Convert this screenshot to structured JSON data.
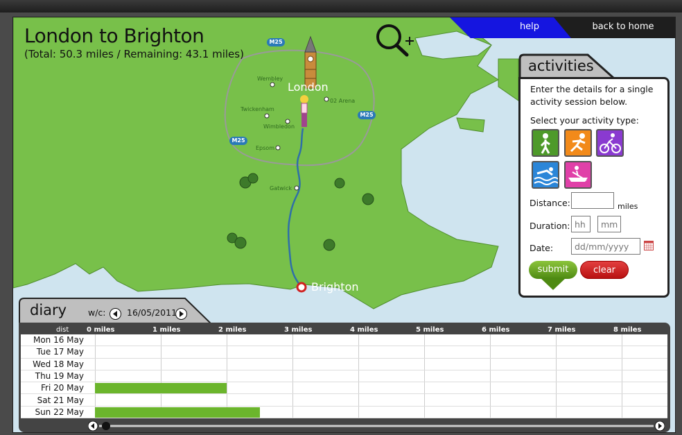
{
  "header": {
    "title": "London to Brighton",
    "subtitle": "(Total: 50.3 miles / Remaining: 43.1 miles)"
  },
  "nav": {
    "help": "help",
    "back_home": "back to home"
  },
  "colors": {
    "land": "#78c04a",
    "sea": "#cfe4ef",
    "route": "#2f6fa8",
    "nav_blue": "#1515e0",
    "panel_grey": "#bfbfbf",
    "diary_dark": "#444444",
    "bar_green": "#6bb52c"
  },
  "map": {
    "places": {
      "wembley": "Wembley",
      "london": "London",
      "o2": "02 Arena",
      "twickenham": "Twickenham",
      "wimbledon": "Wimbledon",
      "epsom": "Epsom",
      "gatwick": "Gatwick",
      "brighton": "Brighton"
    },
    "road_label": "M25",
    "icons": [
      "zoom-in-icon",
      "big-ben-icon",
      "walker-avatar-icon",
      "tree-icon",
      "finish-marker-icon"
    ]
  },
  "activities": {
    "title": "activities",
    "intro": "Enter the details for a single activity session below.",
    "select_label": "Select your activity type:",
    "activity_types": [
      "walking",
      "running",
      "cycling",
      "swimming",
      "rowing"
    ],
    "distance_label": "Distance:",
    "distance_unit": "miles",
    "duration_label": "Duration:",
    "duration_hh": "hh",
    "duration_sep": ":",
    "duration_mm": "mm",
    "date_label": "Date:",
    "date_placeholder": "dd/mm/yyyy",
    "submit": "submit",
    "clear": "clear"
  },
  "diary": {
    "title": "diary",
    "wc_label": "w/c:",
    "week": "16/05/2011",
    "dist_header": "dist",
    "miles": [
      "0 miles",
      "1 miles",
      "2 miles",
      "3 miles",
      "4 miles",
      "5 miles",
      "6 miles",
      "7 miles",
      "8 miles"
    ],
    "days": [
      {
        "label": "Mon 16 May",
        "miles": 0
      },
      {
        "label": "Tue 17 May",
        "miles": 0
      },
      {
        "label": "Wed 18 May",
        "miles": 0
      },
      {
        "label": "Thu 19 May",
        "miles": 0
      },
      {
        "label": "Fri 20 May",
        "miles": 2.0
      },
      {
        "label": "Sat 21 May",
        "miles": 0
      },
      {
        "label": "Sun 22 May",
        "miles": 2.5
      }
    ]
  }
}
